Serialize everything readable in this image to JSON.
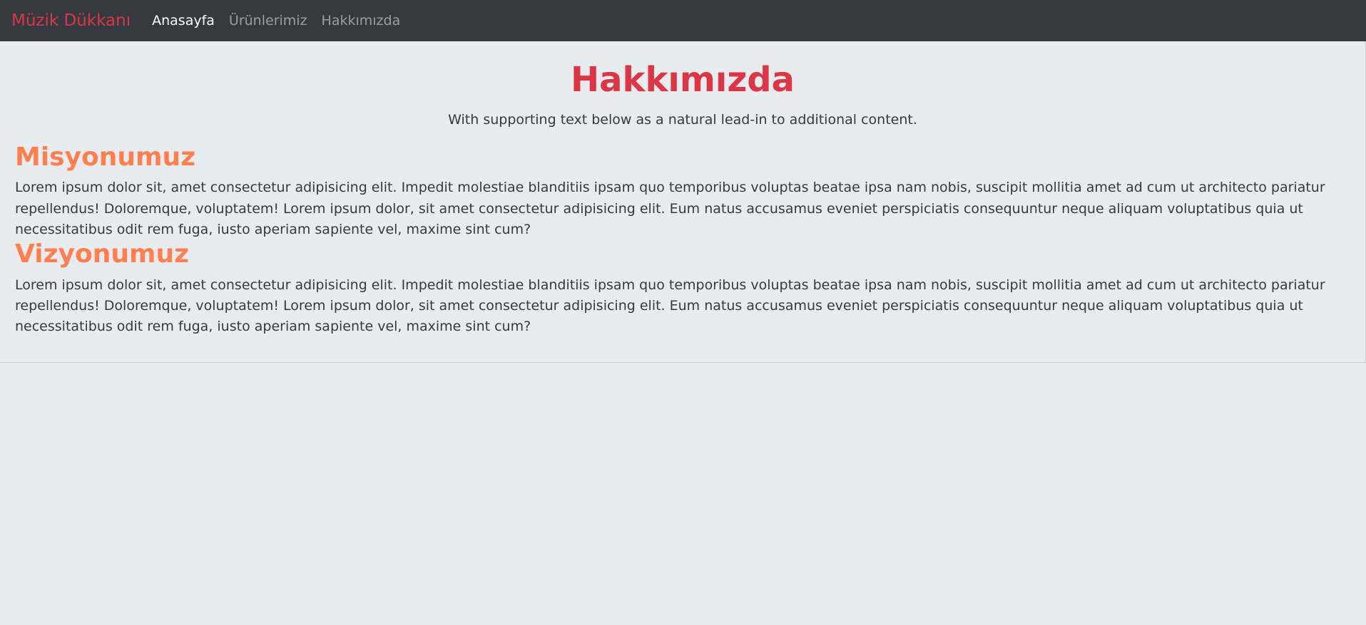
{
  "navbar": {
    "brand": "Müzik Dükkanı",
    "items": [
      {
        "label": "Anasayfa",
        "active": true
      },
      {
        "label": "Ürünlerimiz",
        "active": false
      },
      {
        "label": "Hakkımızda",
        "active": false
      }
    ]
  },
  "main": {
    "title": "Hakkımızda",
    "lead": "With supporting text below as a natural lead-in to additional content.",
    "sections": [
      {
        "heading": "Misyonumuz",
        "text": "Lorem ipsum dolor sit, amet consectetur adipisicing elit. Impedit molestiae blanditiis ipsam quo temporibus voluptas beatae ipsa nam nobis, suscipit mollitia amet ad cum ut architecto pariatur repellendus! Doloremque, voluptatem! Lorem ipsum dolor, sit amet consectetur adipisicing elit. Eum natus accusamus eveniet perspiciatis consequuntur neque aliquam voluptatibus quia ut necessitatibus odit rem fuga, iusto aperiam sapiente vel, maxime sint cum?"
      },
      {
        "heading": "Vizyonumuz",
        "text": "Lorem ipsum dolor sit, amet consectetur adipisicing elit. Impedit molestiae blanditiis ipsam quo temporibus voluptas beatae ipsa nam nobis, suscipit mollitia amet ad cum ut architecto pariatur repellendus! Doloremque, voluptatem! Lorem ipsum dolor, sit amet consectetur adipisicing elit. Eum natus accusamus eveniet perspiciatis consequuntur neque aliquam voluptatibus quia ut necessitatibus odit rem fuga, iusto aperiam sapiente vel, maxime sint cum?"
      }
    ]
  },
  "colors": {
    "navbar_bg": "#343a40",
    "brand": "#dc3545",
    "page_bg": "#e9ecef",
    "section_heading": "#ff7f50"
  }
}
